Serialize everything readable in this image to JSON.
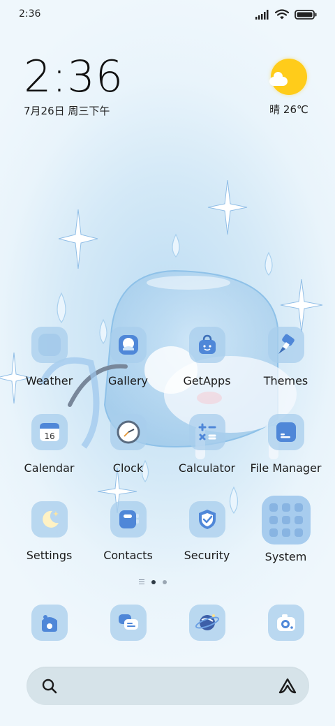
{
  "status_bar": {
    "time": "2:36",
    "icons": [
      "signal-icon",
      "wifi-icon",
      "battery-icon"
    ]
  },
  "clock_widget": {
    "time": "2:36",
    "date": "7月26日 周三下午"
  },
  "weather_widget": {
    "icon": "sunny-partly-cloudy-icon",
    "text": "晴 26℃"
  },
  "apps": [
    {
      "id": "weather",
      "label": "Weather",
      "icon": "weather-icon"
    },
    {
      "id": "gallery",
      "label": "Gallery",
      "icon": "gallery-icon"
    },
    {
      "id": "getapps",
      "label": "GetApps",
      "icon": "getapps-bag-icon"
    },
    {
      "id": "themes",
      "label": "Themes",
      "icon": "themes-brush-icon"
    },
    {
      "id": "calendar",
      "label": "Calendar",
      "icon": "calendar-icon",
      "day": "16"
    },
    {
      "id": "clock",
      "label": "Clock",
      "icon": "clock-icon"
    },
    {
      "id": "calculator",
      "label": "Calculator",
      "icon": "calculator-icon"
    },
    {
      "id": "file-manager",
      "label": "File Manager",
      "icon": "folder-icon"
    },
    {
      "id": "settings",
      "label": "Settings",
      "icon": "settings-moon-icon"
    },
    {
      "id": "contacts",
      "label": "Contacts",
      "icon": "contacts-icon"
    },
    {
      "id": "security",
      "label": "Security",
      "icon": "shield-check-icon"
    },
    {
      "id": "system",
      "label": "System",
      "icon": "folder-grid-icon"
    }
  ],
  "page_indicator": {
    "pages": 2,
    "active": 1
  },
  "dock": [
    {
      "id": "phone",
      "icon": "phone-icon"
    },
    {
      "id": "messages",
      "icon": "messages-icon"
    },
    {
      "id": "browser",
      "icon": "planet-browser-icon"
    },
    {
      "id": "camera",
      "icon": "camera-icon"
    }
  ],
  "search_bar": {
    "left_icon": "search-icon",
    "right_icon": "assistant-icon"
  },
  "colors": {
    "icon_bg": "#a8cdec",
    "accent_blue": "#4c86d6",
    "sun": "#ffcc1a"
  }
}
